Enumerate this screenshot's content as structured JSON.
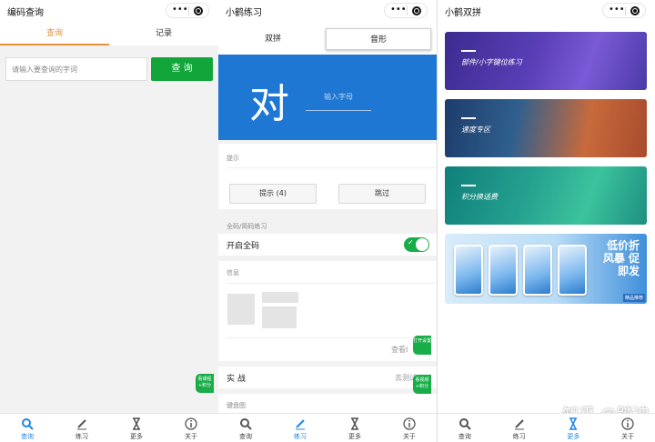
{
  "panel1": {
    "title": "编码查询",
    "tabs": [
      "查询",
      "记录"
    ],
    "search": {
      "placeholder": "请输入要查询的字词",
      "button": "查 询"
    },
    "float_badge": "看课程+积分"
  },
  "panel2": {
    "title": "小鹤练习",
    "segments": [
      "双拼",
      "音形"
    ],
    "practice_char": "对",
    "input_placeholder": "输入字母",
    "hint_section": "提示",
    "hint_button": "提示 (4)",
    "skip_button": "跳过",
    "fullcode_group": "全码/简码练习",
    "fullcode_toggle_label": "开启全码",
    "fullcode_enabled": true,
    "info_section": "信息",
    "info_link": "查看I",
    "open_settings_badge": "打开设置",
    "combat_label": "实 战",
    "combat_link": "去测试",
    "combat_badge": "看视频+积分",
    "keyboard_section": "键盘图"
  },
  "panel3": {
    "title": "小鹤双拼",
    "cards": [
      "部件/小字键位练习",
      "速度专区",
      "积分换话费"
    ],
    "promo_text": "低价折风暴 促即发",
    "promo_tag": "精品推荐",
    "watermark": "知乎 @踏迫"
  },
  "tabbar": [
    "查询",
    "练习",
    "更多",
    "关于"
  ],
  "colors": {
    "accent_blue": "#1e77d3",
    "green": "#12a63a",
    "orange": "#e8913a",
    "active_tab": "#1e88e5"
  }
}
